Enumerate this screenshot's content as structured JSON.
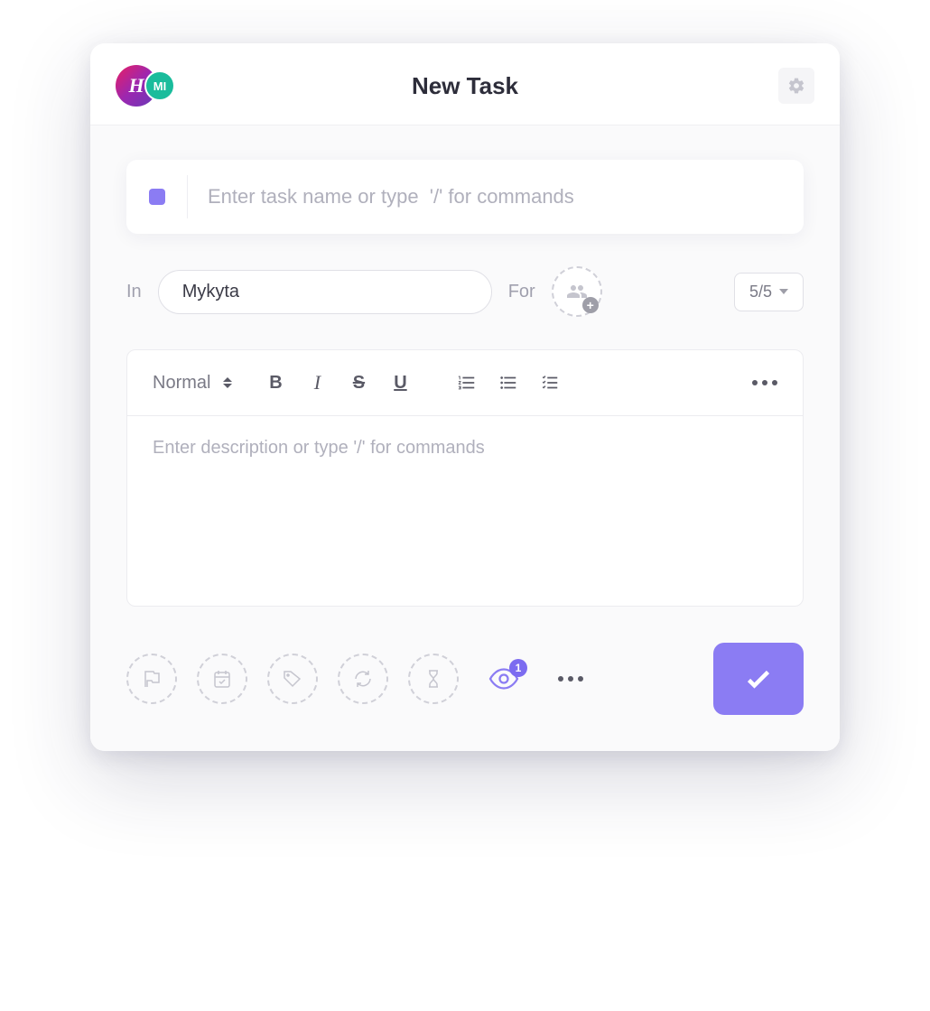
{
  "header": {
    "title": "New Task",
    "workspace_initial": "H",
    "user_initials": "MI"
  },
  "task_name": {
    "placeholder": "Enter task name or type  '/' for commands",
    "value": ""
  },
  "meta": {
    "in_label": "In",
    "in_value": "Mykyta",
    "for_label": "For",
    "priority_label": "5/5"
  },
  "editor": {
    "format_label": "Normal",
    "placeholder": "Enter description or type '/' for commands"
  },
  "watchers": {
    "count": "1"
  }
}
